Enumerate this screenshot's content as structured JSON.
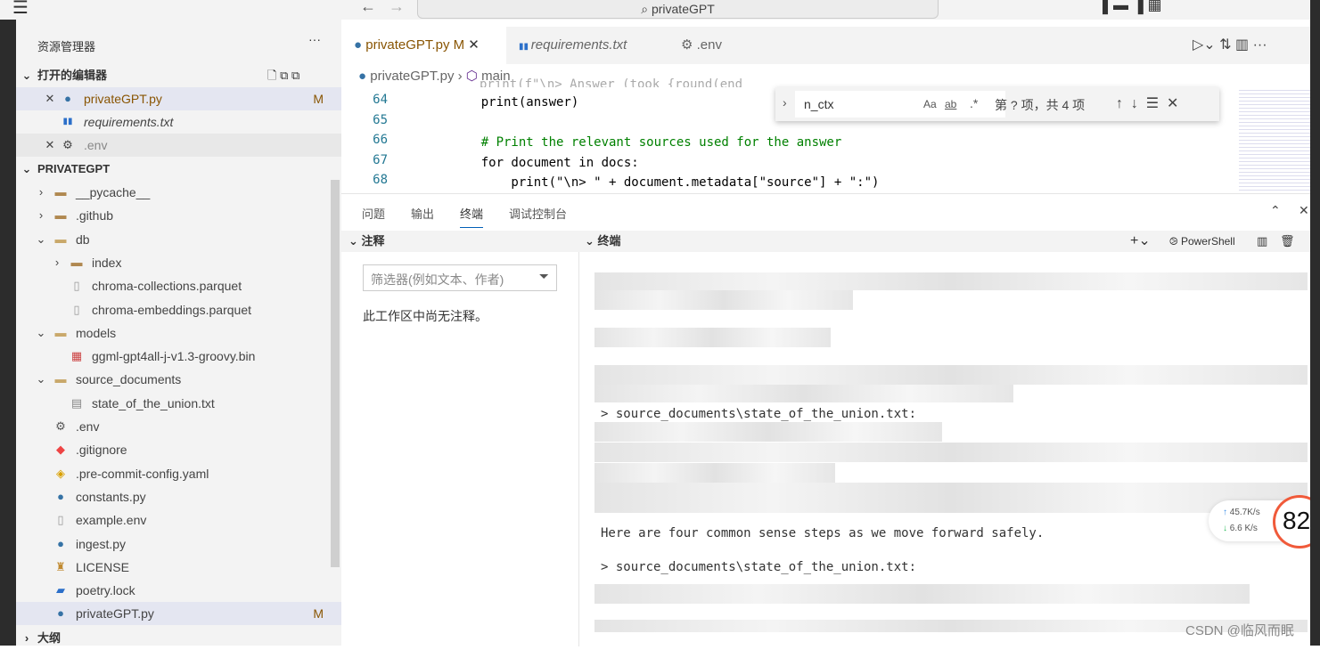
{
  "titlebar": {
    "search": "privateGPT"
  },
  "sidebar": {
    "title": "资源管理器",
    "open_editors": "打开的编辑器",
    "open_files": [
      {
        "name": "privateGPT.py",
        "badge": "M"
      },
      {
        "name": "requirements.txt"
      },
      {
        "name": ".env"
      }
    ],
    "project": "PRIVATEGPT",
    "tree": [
      {
        "name": "__pycache__"
      },
      {
        "name": ".github"
      },
      {
        "name": "db"
      },
      {
        "name": "index"
      },
      {
        "name": "chroma-collections.parquet"
      },
      {
        "name": "chroma-embeddings.parquet"
      },
      {
        "name": "models"
      },
      {
        "name": "ggml-gpt4all-j-v1.3-groovy.bin"
      },
      {
        "name": "source_documents"
      },
      {
        "name": "state_of_the_union.txt"
      },
      {
        "name": ".env"
      },
      {
        "name": ".gitignore"
      },
      {
        "name": ".pre-commit-config.yaml"
      },
      {
        "name": "constants.py"
      },
      {
        "name": "example.env"
      },
      {
        "name": "ingest.py"
      },
      {
        "name": "LICENSE"
      },
      {
        "name": "poetry.lock"
      },
      {
        "name": "privateGPT.py",
        "badge": "M"
      }
    ],
    "outline": "大纲"
  },
  "tabs": [
    {
      "label": "privateGPT.py",
      "badge": "M"
    },
    {
      "label": "requirements.txt"
    },
    {
      "label": ".env"
    }
  ],
  "breadcrumb": {
    "file": "privateGPT.py",
    "symbol": "main"
  },
  "code": [
    {
      "n": "64",
      "text": "    print(answer)"
    },
    {
      "n": "65",
      "text": ""
    },
    {
      "n": "66",
      "text": "    # Print the relevant sources used for the answer"
    },
    {
      "n": "67",
      "text": "    for document in docs:"
    },
    {
      "n": "68",
      "text": "        print(\"\\n> \" + document.metadata[\"source\"] + \":\")"
    }
  ],
  "find": {
    "value": "n_ctx",
    "case": "Aa",
    "word": "ab",
    "regex": ".*",
    "result": "第 ? 项，共 4 项"
  },
  "panel": {
    "tabs": [
      "问题",
      "输出",
      "终端",
      "调试控制台"
    ],
    "active": "终端",
    "comments": {
      "title": "注释",
      "filter_placeholder": "筛选器(例如文本、作者)",
      "empty": "此工作区中尚无注释。"
    },
    "terminal": {
      "title": "终端",
      "shell": "PowerShell",
      "lines": [
        "> source_documents\\state_of_the_union.txt:",
        "Here are four common sense steps as we move forward safely.",
        "> source_documents\\state_of_the_union.txt:"
      ]
    }
  },
  "netwidget": {
    "up": "45.7K/s",
    "down": "6.6 K/s",
    "percent": "82",
    "unit": "%"
  },
  "watermark": "CSDN @临风而眠"
}
